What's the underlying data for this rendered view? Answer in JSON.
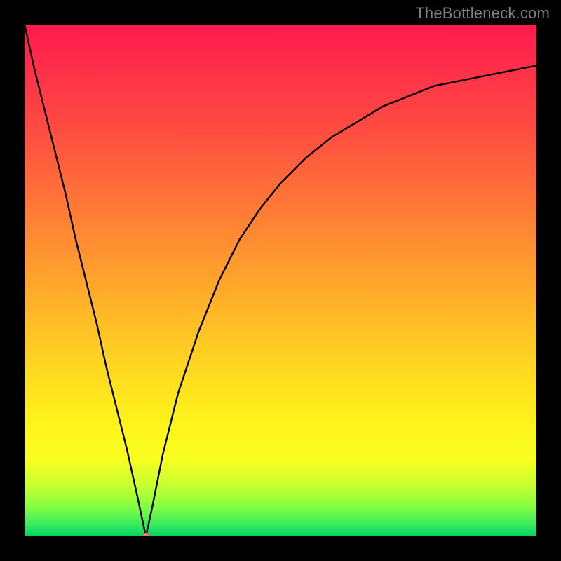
{
  "watermark": "TheBottleneck.com",
  "chart_data": {
    "type": "line",
    "title": "",
    "xlabel": "",
    "ylabel": "",
    "xlim": [
      0,
      100
    ],
    "ylim": [
      0,
      100
    ],
    "background_gradient": {
      "top": "#ff1a4f",
      "bottom": "#00d060",
      "description": "vertical red-to-green spectrum"
    },
    "series": [
      {
        "name": "bottleneck-curve",
        "color": "#000000",
        "x": [
          0,
          2,
          4,
          6,
          8,
          10,
          12,
          14,
          16,
          18,
          20,
          22,
          23.7,
          25,
          27,
          30,
          34,
          38,
          42,
          46,
          50,
          55,
          60,
          65,
          70,
          75,
          80,
          85,
          90,
          95,
          100
        ],
        "values": [
          100,
          91,
          83,
          75,
          67,
          58,
          50,
          42,
          33,
          25,
          17,
          8,
          0,
          6,
          16,
          28,
          40,
          50,
          58,
          64,
          69,
          74,
          78,
          81,
          84,
          86,
          88,
          89,
          90,
          91,
          92
        ]
      }
    ],
    "markers": [
      {
        "name": "current-point",
        "x": 23.7,
        "y": 0,
        "color": "#e77a7a",
        "r": 5
      }
    ],
    "annotations": []
  }
}
